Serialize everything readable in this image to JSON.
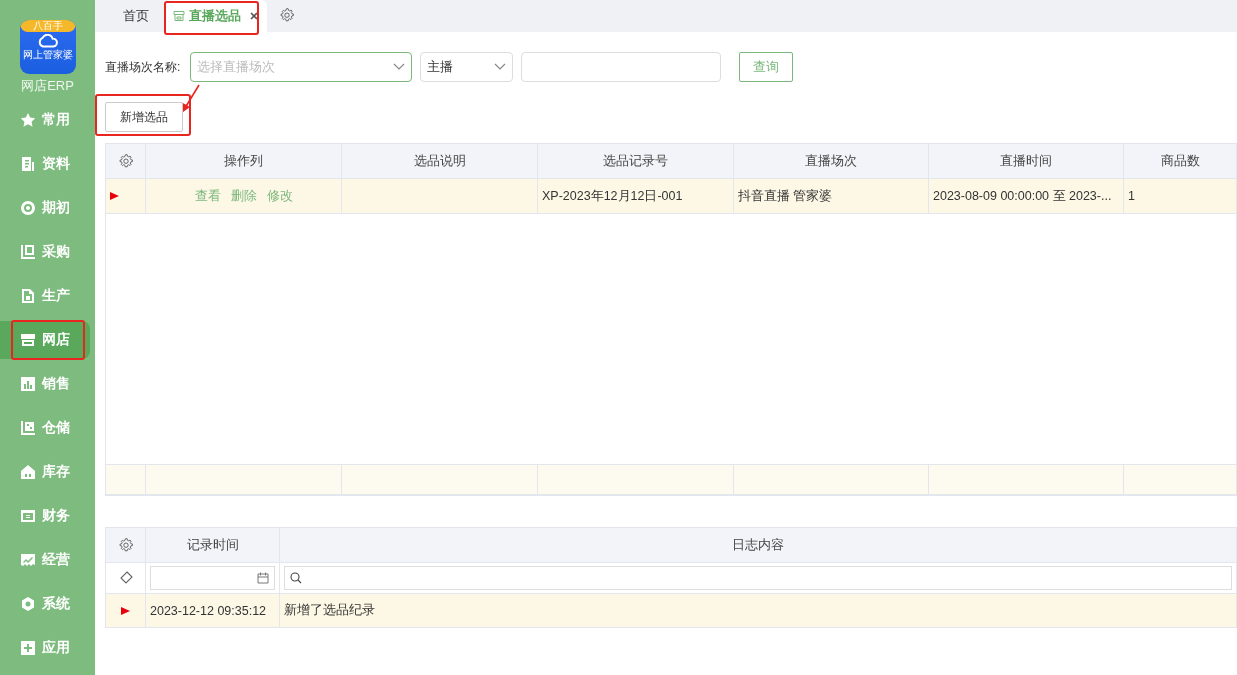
{
  "sidebar": {
    "logo": {
      "badge": "八百手",
      "caption": "网上管家婆",
      "label": "网店ERP"
    },
    "items": [
      {
        "label": "常用",
        "selected": false,
        "highlighted": false
      },
      {
        "label": "资料",
        "selected": false,
        "highlighted": false
      },
      {
        "label": "期初",
        "selected": false,
        "highlighted": false
      },
      {
        "label": "采购",
        "selected": false,
        "highlighted": false
      },
      {
        "label": "生产",
        "selected": false,
        "highlighted": false
      },
      {
        "label": "网店",
        "selected": true,
        "highlighted": true
      },
      {
        "label": "销售",
        "selected": false,
        "highlighted": false
      },
      {
        "label": "仓储",
        "selected": false,
        "highlighted": false
      },
      {
        "label": "库存",
        "selected": false,
        "highlighted": false
      },
      {
        "label": "财务",
        "selected": false,
        "highlighted": false
      },
      {
        "label": "经营",
        "selected": false,
        "highlighted": false
      },
      {
        "label": "系统",
        "selected": false,
        "highlighted": false
      },
      {
        "label": "应用",
        "selected": false,
        "highlighted": false
      }
    ]
  },
  "tabs": [
    {
      "label": "首页",
      "selected": false,
      "closable": false,
      "highlighted": false
    },
    {
      "label": "直播选品",
      "selected": true,
      "closable": true,
      "highlighted": true
    }
  ],
  "filter": {
    "label": "直播场次名称:",
    "session": {
      "placeholder": "选择直播场次"
    },
    "role": {
      "value": "主播"
    },
    "query_button": "查询"
  },
  "add_button": {
    "label": "新增选品",
    "highlighted": true
  },
  "main_table": {
    "action_column": "操作列",
    "columns": [
      "选品说明",
      "选品记录号",
      "直播场次",
      "直播时间",
      "商品数"
    ],
    "rows": [
      {
        "selected": true,
        "actions": [
          "查看",
          "删除",
          "修改"
        ],
        "cells": [
          "",
          "XP-2023年12月12日-001",
          "抖音直播 管家婆",
          "2023-08-09 00:00:00 至 2023-...",
          "1"
        ]
      }
    ]
  },
  "log_table": {
    "columns": [
      "记录时间",
      "日志内容"
    ],
    "rows": [
      {
        "selected": true,
        "cells": [
          "2023-12-12 09:35:12",
          "新增了选品纪录"
        ]
      }
    ]
  }
}
